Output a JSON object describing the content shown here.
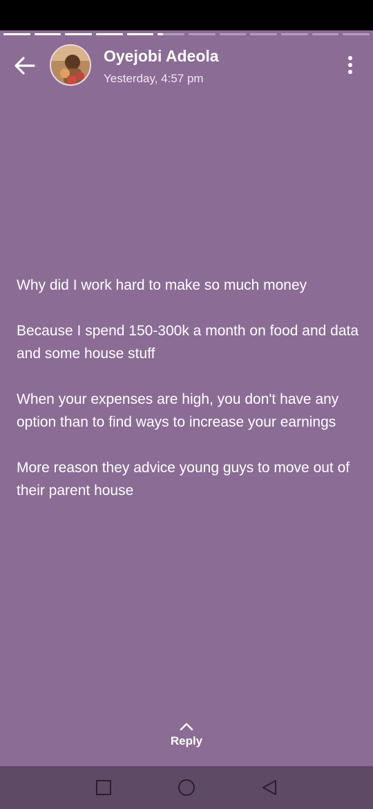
{
  "status_progress": {
    "segments": [
      1,
      1,
      1,
      1,
      1,
      0.2,
      0,
      0,
      0,
      0,
      0,
      0
    ]
  },
  "header": {
    "name": "Oyejobi Adeola",
    "timestamp": "Yesterday, 4:57 pm",
    "back_icon": "arrow-left-icon",
    "menu_icon": "more-vertical-icon"
  },
  "status": {
    "paragraphs": [
      "Why did I work hard to make so much money",
      "Because I spend 150-300k a month on food and data and some house stuff",
      "When your expenses are high, you don't have any option than to find ways to increase your earnings",
      "More reason they advice young guys to move out of their parent house"
    ]
  },
  "reply": {
    "label": "Reply",
    "icon": "chevron-up-icon"
  },
  "navigation": {
    "recents_icon": "square-icon",
    "home_icon": "circle-icon",
    "back_icon": "triangle-back-icon"
  },
  "colors": {
    "background": "#8a6c94",
    "nav_bar": "#5f4a65"
  }
}
